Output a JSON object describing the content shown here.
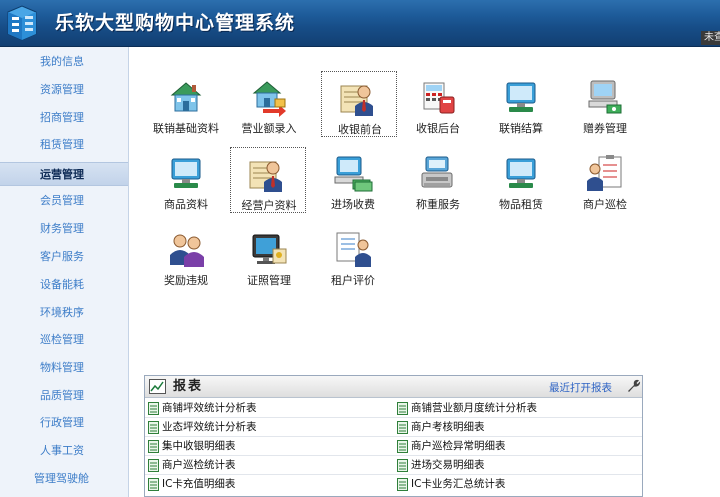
{
  "app": {
    "title": "乐软大型购物中心管理系统",
    "tag": "未查"
  },
  "sidebar": {
    "items": [
      {
        "label": "我的信息",
        "active": false
      },
      {
        "label": "资源管理",
        "active": false
      },
      {
        "label": "招商管理",
        "active": false
      },
      {
        "label": "租赁管理",
        "active": false
      },
      {
        "label": "运营管理",
        "active": true
      },
      {
        "label": "会员管理",
        "active": false
      },
      {
        "label": "财务管理",
        "active": false
      },
      {
        "label": "客户服务",
        "active": false
      },
      {
        "label": "设备能耗",
        "active": false
      },
      {
        "label": "环境秩序",
        "active": false
      },
      {
        "label": "巡检管理",
        "active": false
      },
      {
        "label": "物料管理",
        "active": false
      },
      {
        "label": "品质管理",
        "active": false
      },
      {
        "label": "行政管理",
        "active": false
      },
      {
        "label": "人事工资",
        "active": false
      },
      {
        "label": "管理驾驶舱",
        "active": false
      }
    ]
  },
  "functions": [
    {
      "label": "联销基础资料",
      "icon": "house-icon"
    },
    {
      "label": "营业额录入",
      "icon": "house-arrow-icon"
    },
    {
      "label": "收银前台",
      "icon": "manager-icon",
      "selected": true
    },
    {
      "label": "收银后台",
      "icon": "calculator-icon"
    },
    {
      "label": "联销结算",
      "icon": "monitor-icon"
    },
    {
      "label": "赠券管理",
      "icon": "computer-icon"
    },
    {
      "label": "商品资料",
      "icon": "monitor-icon"
    },
    {
      "label": "经营户资料",
      "icon": "manager-icon",
      "selected": true
    },
    {
      "label": "进场收费",
      "icon": "computer-cash-icon"
    },
    {
      "label": "称重服务",
      "icon": "scale-icon"
    },
    {
      "label": "物品租赁",
      "icon": "monitor-icon"
    },
    {
      "label": "商户巡检",
      "icon": "clipboard-person-icon"
    },
    {
      "label": "奖励违规",
      "icon": "people-icon"
    },
    {
      "label": "证照管理",
      "icon": "certificate-icon"
    },
    {
      "label": "租户评价",
      "icon": "document-person-icon"
    }
  ],
  "reports": {
    "title": "报表",
    "recent_label": "最近打开报表",
    "rows": [
      [
        "商铺坪效统计分析表",
        "商铺营业额月度统计分析表"
      ],
      [
        "业态坪效统计分析表",
        "商户考核明细表"
      ],
      [
        "集中收银明细表",
        "商户巡检异常明细表"
      ],
      [
        "商户巡检统计表",
        "进场交易明细表"
      ],
      [
        "IC卡充值明细表",
        "IC卡业务汇总统计表"
      ]
    ]
  },
  "colors": {
    "titlebar": "#1d5a98",
    "sidebar_bg": "#eef3fa",
    "nav_text": "#3d7dc8",
    "link": "#2f64c4"
  }
}
